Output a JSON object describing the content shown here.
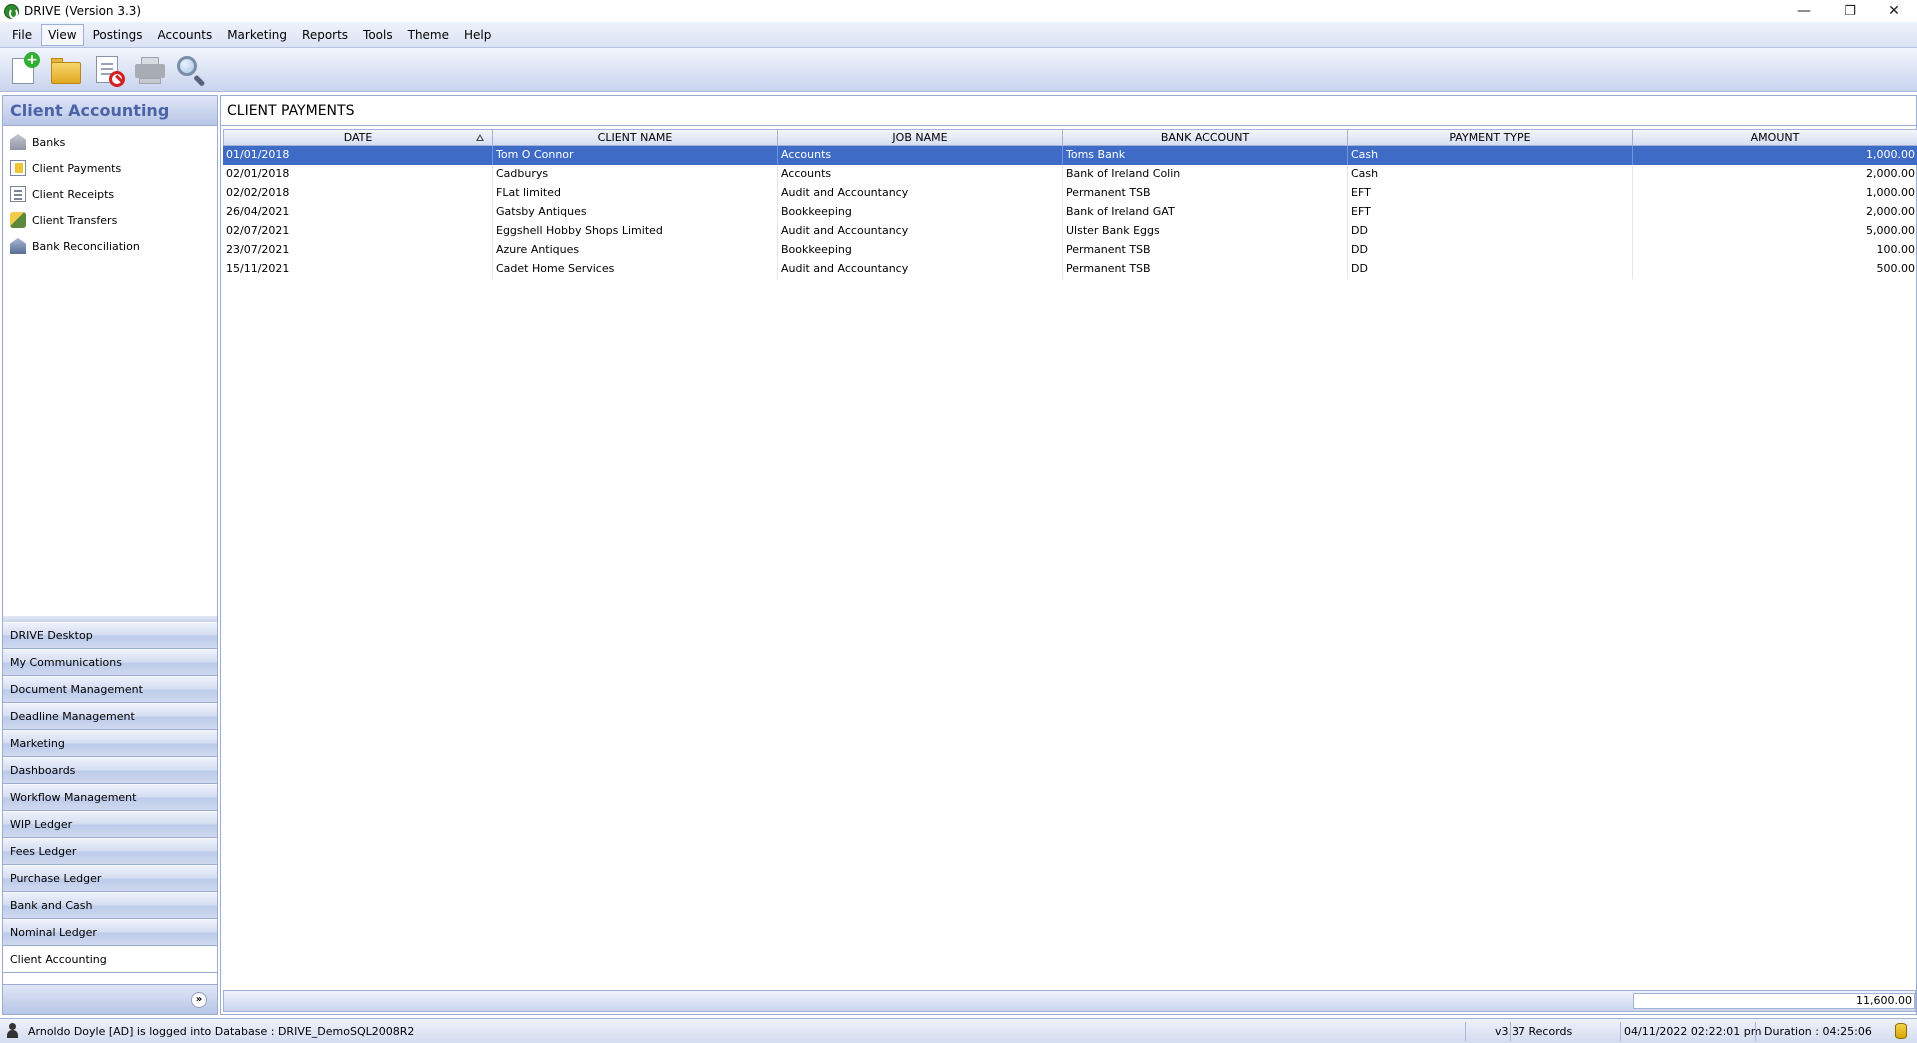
{
  "window": {
    "title": "DRIVE (Version 3.3)",
    "minimize": "—",
    "restore": "❐",
    "close": "✕"
  },
  "menu": [
    "File",
    "View",
    "Postings",
    "Accounts",
    "Marketing",
    "Reports",
    "Tools",
    "Theme",
    "Help"
  ],
  "toolbar": {
    "icons": [
      "new-document-icon",
      "open-folder-icon",
      "delete-document-icon",
      "printer-icon",
      "magnifier-icon"
    ]
  },
  "sidebar": {
    "title": "Client Accounting",
    "items": [
      {
        "label": "Banks",
        "icon": "bank-icon"
      },
      {
        "label": "Client Payments",
        "icon": "payment-icon"
      },
      {
        "label": "Client Receipts",
        "icon": "receipt-icon"
      },
      {
        "label": "Client Transfers",
        "icon": "transfer-icon"
      },
      {
        "label": "Bank Reconciliation",
        "icon": "reconciliation-icon"
      }
    ],
    "modules": [
      "DRIVE Desktop",
      "My Communications",
      "Document Management",
      "Deadline Management",
      "Marketing",
      "Dashboards",
      "Workflow Management",
      "WIP Ledger",
      "Fees Ledger",
      "Purchase Ledger",
      "Bank and Cash",
      "Nominal Ledger",
      "Client Accounting"
    ],
    "active_module": "Client Accounting",
    "footer_chevron": "»"
  },
  "main": {
    "title": "CLIENT PAYMENTS",
    "columns": [
      "DATE",
      "CLIENT NAME",
      "JOB NAME",
      "BANK ACCOUNT",
      "PAYMENT TYPE",
      "AMOUNT"
    ],
    "sorted_column": "DATE",
    "rows": [
      {
        "date": "01/01/2018",
        "client": "Tom O Connor",
        "job": "Accounts",
        "bank": "Toms Bank",
        "type": "Cash",
        "amount": "1,000.00",
        "selected": true
      },
      {
        "date": "02/01/2018",
        "client": "Cadburys",
        "job": "Accounts",
        "bank": "Bank of Ireland Colin",
        "type": "Cash",
        "amount": "2,000.00"
      },
      {
        "date": "02/02/2018",
        "client": "FLat limited",
        "job": "Audit and Accountancy",
        "bank": "Permanent TSB",
        "type": "EFT",
        "amount": "1,000.00"
      },
      {
        "date": "26/04/2021",
        "client": "Gatsby Antiques",
        "job": "Bookkeeping",
        "bank": "Bank of Ireland GAT",
        "type": "EFT",
        "amount": "2,000.00"
      },
      {
        "date": "02/07/2021",
        "client": "Eggshell Hobby Shops Limited",
        "job": "Audit and Accountancy",
        "bank": "Ulster Bank Eggs",
        "type": "DD",
        "amount": "5,000.00"
      },
      {
        "date": "23/07/2021",
        "client": "Azure Antiques",
        "job": "Bookkeeping",
        "bank": "Permanent TSB",
        "type": "DD",
        "amount": "100.00"
      },
      {
        "date": "15/11/2021",
        "client": "Cadet Home Services",
        "job": "Audit and Accountancy",
        "bank": "Permanent TSB",
        "type": "DD",
        "amount": "500.00"
      }
    ],
    "total_amount": "11,600.00"
  },
  "status": {
    "login": "Arnoldo Doyle [AD] is logged into Database : DRIVE_DemoSQL2008R2",
    "version": "v3.3",
    "records": "7 Records",
    "datetime": "04/11/2022 02:22:01 pm",
    "duration": "Duration : 04:25:06"
  },
  "colors": {
    "selection": "#3d6bc5",
    "header_text": "#4d63a8",
    "panel_border": "#9cacd1"
  }
}
